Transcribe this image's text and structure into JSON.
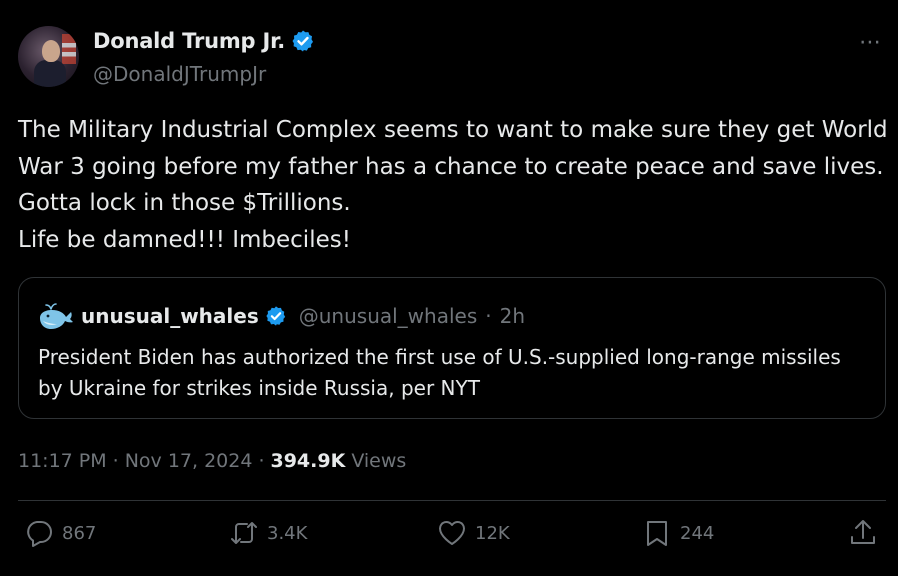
{
  "author": {
    "display_name": "Donald Trump Jr.",
    "handle": "@DonaldJTrumpJr",
    "verified": true
  },
  "more_icon": "⋯",
  "tweet": {
    "lines": [
      "The Military Industrial Complex seems to want to make sure they get World",
      "War 3 going before my father has a chance to create peace and save lives.",
      "Gotta lock in those $Trillions.",
      "Life be damned!!! Imbeciles!"
    ]
  },
  "quoted": {
    "display_name": "unusual_whales",
    "handle": "@unusual_whales",
    "age": "2h",
    "separator": "·",
    "lines": [
      "President Biden has authorized the first use of U.S.-supplied long-range missiles",
      "by Ukraine for strikes inside Russia, per NYT"
    ]
  },
  "meta": {
    "time": "11:17 PM",
    "date": "Nov 17, 2024",
    "views_count": "394.9K",
    "views_label": "Views",
    "separator": "·"
  },
  "actions": {
    "replies": "867",
    "reposts": "3.4K",
    "likes": "12K",
    "bookmarks": "244"
  },
  "colors": {
    "background": "#000000",
    "text": "#e7e9ea",
    "muted": "#71767b",
    "border": "#2f3336",
    "verified": "#1d9bf0"
  }
}
